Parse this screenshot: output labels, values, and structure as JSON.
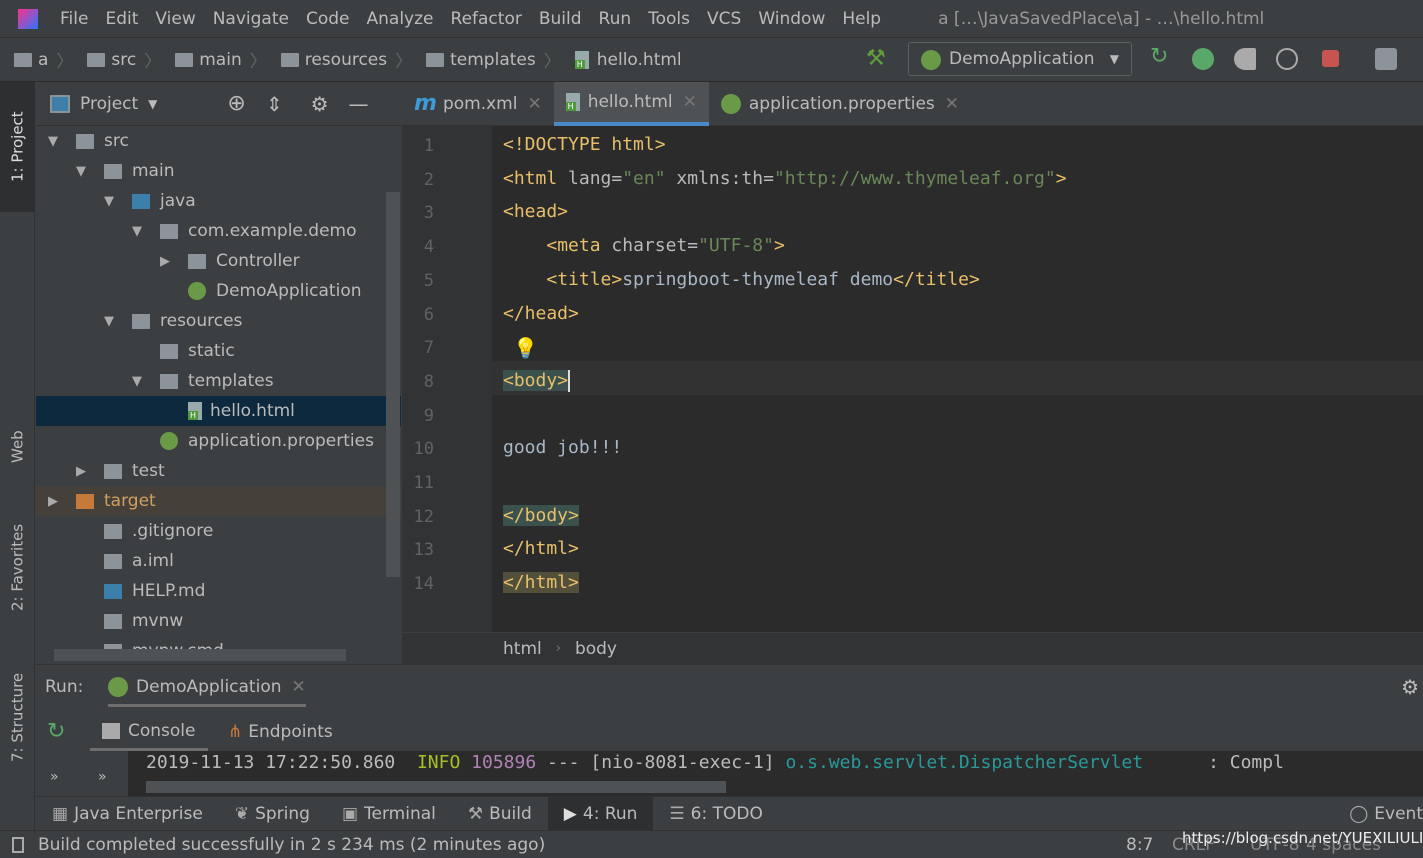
{
  "menu": {
    "items": [
      "File",
      "Edit",
      "View",
      "Navigate",
      "Code",
      "Analyze",
      "Refactor",
      "Build",
      "Run",
      "Tools",
      "VCS",
      "Window",
      "Help"
    ],
    "title": "a […\\JavaSavedPlace\\a] - …\\hello.html"
  },
  "breadcrumb": [
    "a",
    "src",
    "main",
    "resources",
    "templates",
    "hello.html"
  ],
  "run_config": "DemoApplication",
  "left_tabs": [
    "1: Project",
    "Web",
    "2: Favorites",
    "7: Structure"
  ],
  "project": {
    "title": "Project",
    "tree": [
      {
        "label": "src",
        "depth": 0,
        "arrow": "▼",
        "kind": "folder"
      },
      {
        "label": "main",
        "depth": 1,
        "arrow": "▼",
        "kind": "folder"
      },
      {
        "label": "java",
        "depth": 2,
        "arrow": "▼",
        "kind": "src"
      },
      {
        "label": "com.example.demo",
        "depth": 3,
        "arrow": "▼",
        "kind": "package"
      },
      {
        "label": "Controller",
        "depth": 4,
        "arrow": "▶",
        "kind": "package"
      },
      {
        "label": "DemoApplication",
        "depth": 4,
        "arrow": "",
        "kind": "spring"
      },
      {
        "label": "resources",
        "depth": 2,
        "arrow": "▼",
        "kind": "res"
      },
      {
        "label": "static",
        "depth": 3,
        "arrow": "",
        "kind": "folder"
      },
      {
        "label": "templates",
        "depth": 3,
        "arrow": "▼",
        "kind": "folder"
      },
      {
        "label": "hello.html",
        "depth": 4,
        "arrow": "",
        "kind": "html",
        "selected": true
      },
      {
        "label": "application.properties",
        "depth": 3,
        "arrow": "",
        "kind": "spring"
      },
      {
        "label": "test",
        "depth": 1,
        "arrow": "▶",
        "kind": "folder"
      },
      {
        "label": "target",
        "depth": 0,
        "arrow": "▶",
        "kind": "target",
        "highlight": true
      },
      {
        "label": ".gitignore",
        "depth": 1,
        "arrow": "",
        "kind": "file"
      },
      {
        "label": "a.iml",
        "depth": 1,
        "arrow": "",
        "kind": "file"
      },
      {
        "label": "HELP.md",
        "depth": 1,
        "arrow": "",
        "kind": "md"
      },
      {
        "label": "mvnw",
        "depth": 1,
        "arrow": "",
        "kind": "file"
      },
      {
        "label": "mvnw.cmd",
        "depth": 1,
        "arrow": "",
        "kind": "file"
      }
    ]
  },
  "tabs": [
    "pom.xml",
    "hello.html",
    "application.properties"
  ],
  "active_tab": "hello.html",
  "code": [
    [
      [
        "t",
        "<!DOCTYPE html>"
      ]
    ],
    [
      [
        "t",
        "<html "
      ],
      [
        "a",
        "lang="
      ],
      [
        "v",
        "\"en\""
      ],
      [
        "a",
        " xmlns:th="
      ],
      [
        "v",
        "\"http://www.thymeleaf.org\""
      ],
      [
        "t",
        ">"
      ]
    ],
    [
      [
        "t",
        "<head>"
      ]
    ],
    [
      [
        "p",
        "    "
      ],
      [
        "t",
        "<meta "
      ],
      [
        "a",
        "charset="
      ],
      [
        "v",
        "\"UTF-8\""
      ],
      [
        "t",
        ">"
      ]
    ],
    [
      [
        "p",
        "    "
      ],
      [
        "t",
        "<title>"
      ],
      [
        "p",
        "springboot-thymeleaf demo"
      ],
      [
        "t",
        "</title>"
      ]
    ],
    [
      [
        "t",
        "</head>"
      ]
    ],
    [],
    [
      [
        "t",
        "<body>"
      ]
    ],
    [],
    [
      [
        "p",
        "good job!!!"
      ]
    ],
    [],
    [
      [
        "t",
        "</body>"
      ]
    ],
    [
      [
        "t",
        "</html>"
      ]
    ],
    [
      [
        "t",
        "</html>"
      ]
    ]
  ],
  "editor_breadcrumb": [
    "html",
    "body"
  ],
  "run": {
    "label": "Run:",
    "tab": "DemoApplication",
    "subtabs": [
      "Console",
      "Endpoints"
    ],
    "log": {
      "timestamp": "2019-11-13 17:22:50.860",
      "level": "INFO",
      "pid": "105896",
      "sep": " --- ",
      "thread": "[nio-8081-exec-1]",
      "logger": "o.s.web.servlet.DispatcherServlet",
      "msg": "      : Compl"
    }
  },
  "toolwindows": [
    "Java Enterprise",
    "Spring",
    "Terminal",
    "Build",
    "4: Run",
    "6: TODO",
    "Event"
  ],
  "status": {
    "message": "Build completed successfully in 2 s 234 ms (2 minutes ago)",
    "position": "8:7",
    "line_sep": "CRLF",
    "encoding": "UTF-8",
    "indent": "4 spaces",
    "watermark": "https://blog.csdn.net/YUEXILIULI"
  }
}
